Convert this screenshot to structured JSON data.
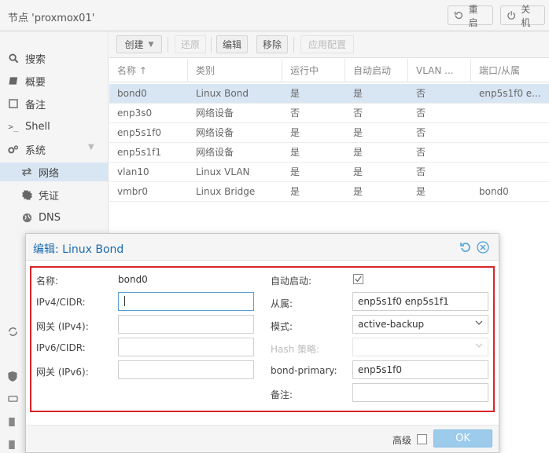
{
  "header": {
    "title": "节点 'proxmox01'",
    "reload_label": "重启",
    "shutdown_label": "关机"
  },
  "sidebar": {
    "items": [
      {
        "label": "搜索",
        "icon": "search-icon"
      },
      {
        "label": "概要",
        "icon": "book-icon"
      },
      {
        "label": "备注",
        "icon": "note-icon"
      },
      {
        "label": "Shell",
        "icon": "terminal-icon"
      },
      {
        "label": "系统",
        "icon": "gears-icon"
      },
      {
        "label": "网络",
        "icon": "exchange-icon"
      },
      {
        "label": "凭证",
        "icon": "certificate-icon"
      },
      {
        "label": "DNS",
        "icon": "globe-icon"
      }
    ]
  },
  "toolbar": {
    "create_label": "创建",
    "revert_label": "还原",
    "edit_label": "编辑",
    "remove_label": "移除",
    "apply_label": "应用配置"
  },
  "grid": {
    "columns": [
      "名称 ↑",
      "类别",
      "运行中",
      "自动启动",
      "VLAN ...",
      "端口/从属"
    ],
    "rows": [
      [
        "bond0",
        "Linux Bond",
        "是",
        "是",
        "否",
        "enp5s1f0 e..."
      ],
      [
        "enp3s0",
        "网络设备",
        "否",
        "否",
        "否",
        ""
      ],
      [
        "enp5s1f0",
        "网络设备",
        "是",
        "是",
        "否",
        ""
      ],
      [
        "enp5s1f1",
        "网络设备",
        "是",
        "是",
        "否",
        ""
      ],
      [
        "vlan10",
        "Linux VLAN",
        "是",
        "是",
        "否",
        ""
      ],
      [
        "vmbr0",
        "Linux Bridge",
        "是",
        "是",
        "是",
        "bond0"
      ]
    ]
  },
  "dialog": {
    "title": "编辑: Linux Bond",
    "name_label": "名称:",
    "name_value": "bond0",
    "ipv4_label": "IPv4/CIDR:",
    "ipv4_value": "",
    "gw4_label": "网关 (IPv4):",
    "gw4_value": "",
    "ipv6_label": "IPv6/CIDR:",
    "ipv6_value": "",
    "gw6_label": "网关 (IPv6):",
    "gw6_value": "",
    "autostart_label": "自动启动:",
    "autostart_checked": true,
    "slaves_label": "从属:",
    "slaves_value": "enp5s1f0 enp5s1f1",
    "mode_label": "模式:",
    "mode_value": "active-backup",
    "hash_label": "Hash 策略:",
    "hash_value": "",
    "primary_label": "bond-primary:",
    "primary_value": "enp5s1f0",
    "comment_label": "备注:",
    "comment_value": "",
    "advanced_label": "高级",
    "ok_label": "OK"
  },
  "colors": {
    "accent": "#1c6bb0",
    "selection": "#d8e6f4",
    "highlight_border": "#d9262a",
    "ok_button": "#9ccbec"
  }
}
